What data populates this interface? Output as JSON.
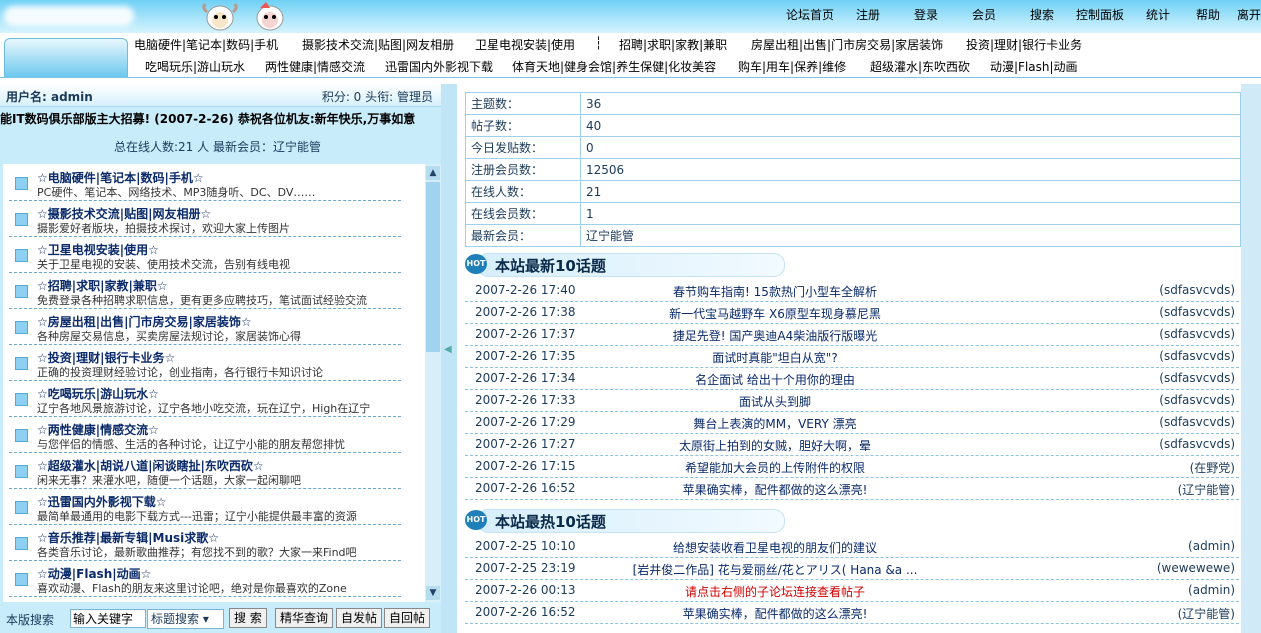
{
  "topnav": [
    "论坛首页",
    "注册",
    "登录",
    "会员",
    "搜索",
    "控制面板",
    "统计",
    "帮助",
    "离开"
  ],
  "nav_row1": [
    "电脑硬件|笔记本|数码|手机",
    "摄影技术交流|贴图|网友相册",
    "卫星电视安装|使用",
    "┆",
    "招聘|求职|家教|兼职",
    "房屋出租|出售|门市房交易|家居装饰",
    "投资|理财|银行卡业务"
  ],
  "nav_row2": [
    "吃喝玩乐|游山玩水",
    "两性健康|情感交流",
    "迅雷国内外影视下载",
    "体育天地|健身会馆|养生保健|化妆美容",
    "购车|用车|保养|维修",
    "超级灌水|东吹西砍",
    "动漫|Flash|动画"
  ],
  "user": {
    "label": "用户名: admin",
    "right": "积分: 0 头衔: 管理员"
  },
  "marquee": "能IT数码俱乐部版主大招募! (2007-2-26)     恭祝各位机友:新年快乐,万事如意",
  "online": "总在线人数:21 人    最新会员：辽宁能管",
  "forums": [
    {
      "t": "☆电脑硬件|笔记本|数码|手机☆",
      "d": "PC硬件、笔记本、网络技术、MP3随身听、DC、DV……"
    },
    {
      "t": "☆摄影技术交流|贴图|网友相册☆",
      "d": "摄影爱好者版块，拍摄技术探讨，欢迎大家上传图片"
    },
    {
      "t": "☆卫星电视安装|使用☆",
      "d": "关于卫星电视的安装、使用技术交流，告别有线电视"
    },
    {
      "t": "☆招聘|求职|家教|兼职☆",
      "d": "免费登录各种招聘求职信息，更有更多应聘技巧，笔试面试经验交流"
    },
    {
      "t": "☆房屋出租|出售|门市房交易|家居装饰☆",
      "d": "各种房屋交易信息，买卖房屋法规讨论，家居装饰心得"
    },
    {
      "t": "☆投资|理财|银行卡业务☆",
      "d": "正确的投资理财经验讨论，创业指南，各行银行卡知识讨论"
    },
    {
      "t": "☆吃喝玩乐|游山玩水☆",
      "d": "辽宁各地风景旅游讨论，辽宁各地小吃交流，玩在辽宁，High在辽宁"
    },
    {
      "t": "☆两性健康|情感交流☆",
      "d": "与您伴侣的情感、生活的各种讨论，让辽宁小能的朋友帮您排忧"
    },
    {
      "t": "☆超级灌水|胡说八道|闲谈瞎扯|东吹西砍☆",
      "d": "闲来无事？来灌水吧，随便一个话题，大家一起闲聊吧"
    },
    {
      "t": "☆迅雷国内外影视下载☆",
      "d": "最简单最通用的电影下载方式---迅雷；辽宁小能提供最丰富的资源"
    },
    {
      "t": "☆音乐推荐|最新专辑|Musi求歌☆",
      "d": "各类音乐讨论，最新歌曲推荐；有您找不到的歌？大家一来Find吧"
    },
    {
      "t": "☆动漫|Flash|动画☆",
      "d": "喜欢动漫、Flash的朋友来这里讨论吧，绝对是你最喜欢的Zone"
    }
  ],
  "search": {
    "label": "本版搜索",
    "placeholder": "输入关键字",
    "select": "标题搜索 ▾",
    "btn_search": "搜 索",
    "btn_elite": "精华查询",
    "btn_mine": "自发帖",
    "btn_reply": "自回帖"
  },
  "stats": [
    [
      "主题数：",
      "36"
    ],
    [
      "帖子数：",
      "40"
    ],
    [
      "今日发贴数：",
      "0"
    ],
    [
      "注册会员数：",
      "12506"
    ],
    [
      "在线人数：",
      "21"
    ],
    [
      "在线会员数：",
      "1"
    ],
    [
      "最新会员：",
      "辽宁能管"
    ]
  ],
  "latest_title": "本站最新10话题",
  "hot_label": "HOT",
  "latest": [
    [
      "2007-2-26 17:40",
      "春节购车指南! 15款热门小型车全解析",
      "(sdfasvcvds)"
    ],
    [
      "2007-2-26 17:38",
      "新一代宝马越野车 X6原型车现身慕尼黑",
      "(sdfasvcvds)"
    ],
    [
      "2007-2-26 17:37",
      "捷足先登! 国产奥迪A4柴油版行版曝光",
      "(sdfasvcvds)"
    ],
    [
      "2007-2-26 17:35",
      "面试时真能\"坦白从宽\"?",
      "(sdfasvcvds)"
    ],
    [
      "2007-2-26 17:34",
      "名企面试 给出十个用你的理由",
      "(sdfasvcvds)"
    ],
    [
      "2007-2-26 17:33",
      "面试从头到脚",
      "(sdfasvcvds)"
    ],
    [
      "2007-2-26 17:29",
      "舞台上表演的MM，VERY 漂亮",
      "(sdfasvcvds)"
    ],
    [
      "2007-2-26 17:27",
      "太原街上拍到的女贼，胆好大啊，晕",
      "(sdfasvcvds)"
    ],
    [
      "2007-2-26 17:15",
      "希望能加大会员的上传附件的权限",
      "(在野党)"
    ],
    [
      "2007-2-26 16:52",
      "苹果确实棒，配件都做的这么漂亮!",
      "(辽宁能管)"
    ]
  ],
  "hot_title": "本站最热10话题",
  "hot": [
    [
      "2007-2-25 10:10",
      "给想安装收看卫星电视的朋友们的建议",
      "(admin)"
    ],
    [
      "2007-2-25 23:19",
      "[岩井俊二作品] 花与爱丽丝/花とアリス( Hana &a ...",
      "(wewewewe)"
    ],
    [
      "2007-2-26 00:13",
      "请点击右侧的子论坛连接查看帖子",
      "(admin)"
    ],
    [
      "2007-2-26 16:52",
      "苹果确实棒，配件都做的这么漂亮!",
      "(辽宁能管)"
    ]
  ]
}
